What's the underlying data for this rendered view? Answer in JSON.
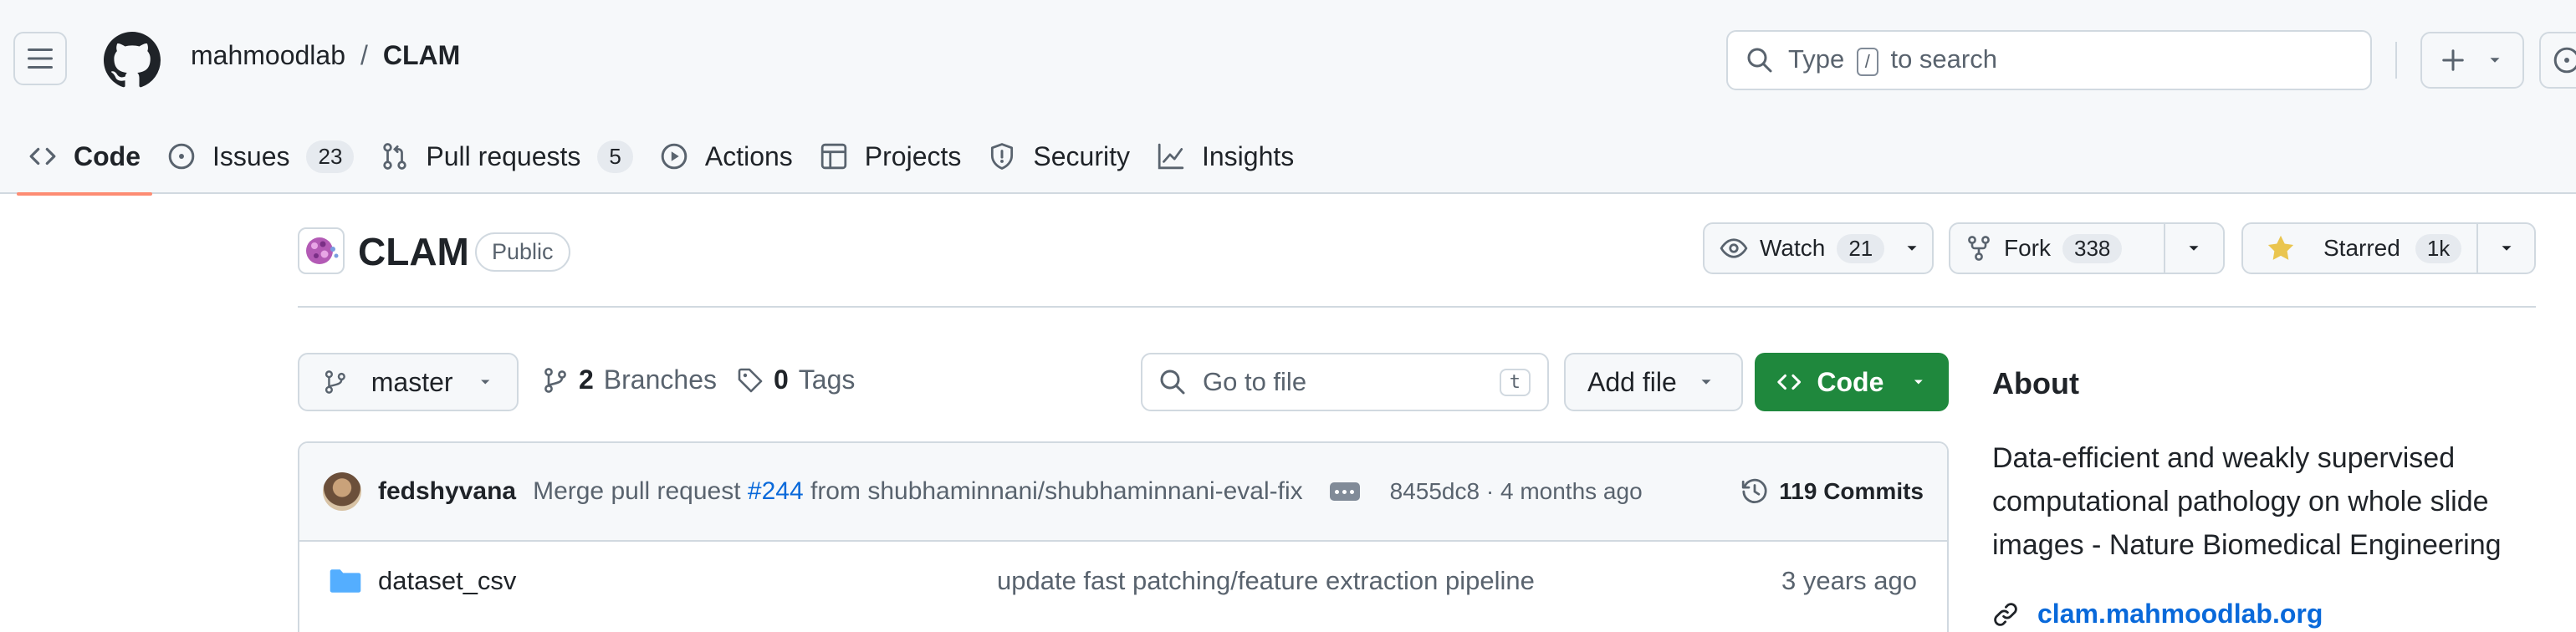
{
  "header": {
    "owner": "mahmoodlab",
    "separator": "/",
    "repo": "CLAM",
    "search": {
      "prefix": "Type",
      "key": "/",
      "suffix": "to search"
    }
  },
  "nav": {
    "tabs": [
      {
        "label": "Code",
        "icon": "code-icon",
        "selected": true
      },
      {
        "label": "Issues",
        "icon": "issue-opened-icon",
        "count": "23"
      },
      {
        "label": "Pull requests",
        "icon": "git-pull-request-icon",
        "count": "5"
      },
      {
        "label": "Actions",
        "icon": "play-icon"
      },
      {
        "label": "Projects",
        "icon": "table-icon"
      },
      {
        "label": "Security",
        "icon": "shield-icon"
      },
      {
        "label": "Insights",
        "icon": "graph-icon"
      }
    ]
  },
  "repo": {
    "title": "CLAM",
    "visibility": "Public",
    "watch": {
      "label": "Watch",
      "count": "21"
    },
    "fork": {
      "label": "Fork",
      "count": "338"
    },
    "star": {
      "label": "Starred",
      "count": "1k"
    }
  },
  "filenav": {
    "branch": "master",
    "branches_count": "2",
    "branches_label": "Branches",
    "tags_count": "0",
    "tags_label": "Tags",
    "goto_placeholder": "Go to file",
    "goto_key": "t",
    "add_file": "Add file",
    "code": "Code"
  },
  "commit": {
    "author": "fedshyvana",
    "message_prefix": "Merge pull request",
    "pr": "#244",
    "message_suffix": "from shubhaminnani/shubhaminnani-eval-fix",
    "sha": "8455dc8",
    "dot": "·",
    "age": "4 months ago",
    "count_label": "119 Commits"
  },
  "files": [
    {
      "name": "dataset_csv",
      "message": "update fast patching/feature extraction pipeline",
      "date": "3 years ago"
    }
  ],
  "about": {
    "heading": "About",
    "description": "Data-efficient and weakly supervised computational pathology on whole slide images - Nature Biomedical Engineering",
    "link": "clam.mahmoodlab.org"
  },
  "colors": {
    "accent_underline": "#fd8c73",
    "primary_button": "#1f883d",
    "link": "#0969da",
    "folder": "#54aeff",
    "star": "#eac54f"
  }
}
